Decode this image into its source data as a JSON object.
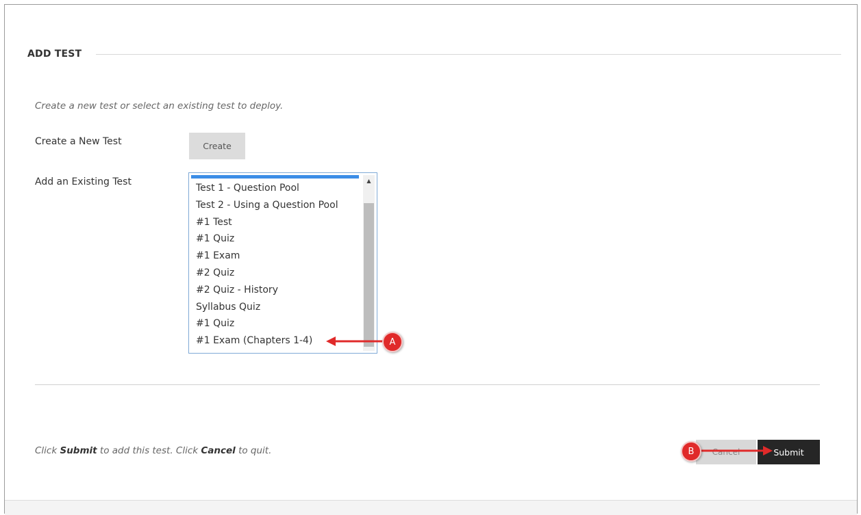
{
  "section": {
    "title": "ADD TEST"
  },
  "instructions": "Create a new test or select an existing test to deploy.",
  "create_new": {
    "label": "Create a New Test",
    "button_label": "Create"
  },
  "existing": {
    "label": "Add an Existing Test",
    "options": [
      "Test 1 - Question Pool",
      "Test 2 - Using a Question Pool",
      "#1 Test",
      "#1 Quiz",
      "#1 Exam",
      "#2 Quiz",
      "#2 Quiz - History",
      "Syllabus Quiz",
      "#1 Quiz",
      "#1 Exam (Chapters 1-4)"
    ]
  },
  "footer": {
    "text_1": "Click ",
    "submit_word": "Submit",
    "text_2": " to add this test. Click ",
    "cancel_word": "Cancel",
    "text_3": " to quit."
  },
  "buttons": {
    "cancel_label": "Cancel",
    "submit_label": "Submit"
  },
  "callouts": {
    "a": "A",
    "b": "B"
  },
  "colors": {
    "accent_red": "#e02a2a",
    "submit_bg": "#262626",
    "selection_blue": "#3b8de6"
  }
}
